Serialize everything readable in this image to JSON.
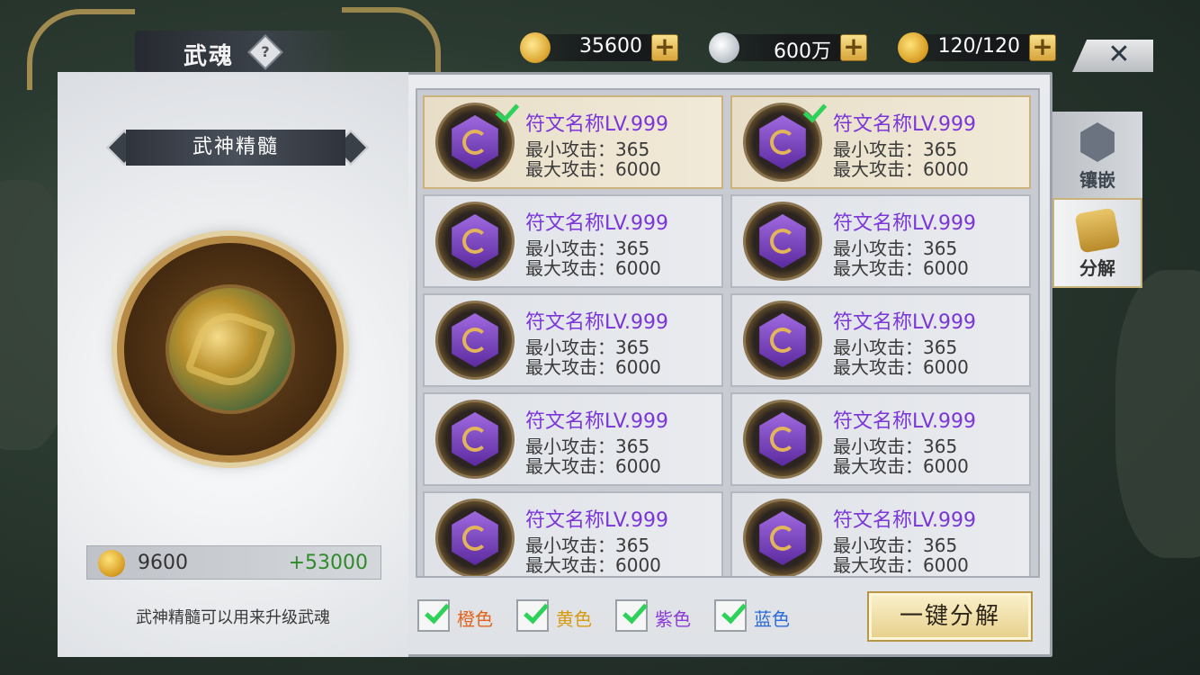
{
  "header": {
    "title": "武魂",
    "help": "?",
    "close": "✕"
  },
  "currencies": [
    {
      "icon": "gold-ingot-icon",
      "value": "35600",
      "plus": "+"
    },
    {
      "icon": "silver-ingot-icon",
      "value": "600万",
      "plus": "+"
    },
    {
      "icon": "coin-icon",
      "value": "120/120",
      "plus": "+"
    }
  ],
  "left": {
    "title": "武神精髓",
    "essence_value": "9600",
    "essence_gain": "+53000",
    "description": "武神精髓可以用来升级武魂"
  },
  "runes": [
    {
      "name": "符文名称LV.999",
      "min": "最小攻击：365",
      "max": "最大攻击：6000",
      "selected": true
    },
    {
      "name": "符文名称LV.999",
      "min": "最小攻击：365",
      "max": "最大攻击：6000",
      "selected": true
    },
    {
      "name": "符文名称LV.999",
      "min": "最小攻击：365",
      "max": "最大攻击：6000",
      "selected": false
    },
    {
      "name": "符文名称LV.999",
      "min": "最小攻击：365",
      "max": "最大攻击：6000",
      "selected": false
    },
    {
      "name": "符文名称LV.999",
      "min": "最小攻击：365",
      "max": "最大攻击：6000",
      "selected": false
    },
    {
      "name": "符文名称LV.999",
      "min": "最小攻击：365",
      "max": "最大攻击：6000",
      "selected": false
    },
    {
      "name": "符文名称LV.999",
      "min": "最小攻击：365",
      "max": "最大攻击：6000",
      "selected": false
    },
    {
      "name": "符文名称LV.999",
      "min": "最小攻击：365",
      "max": "最大攻击：6000",
      "selected": false
    },
    {
      "name": "符文名称LV.999",
      "min": "最小攻击：365",
      "max": "最大攻击：6000",
      "selected": false
    },
    {
      "name": "符文名称LV.999",
      "min": "最小攻击：365",
      "max": "最大攻击：6000",
      "selected": false
    }
  ],
  "filters": [
    {
      "label": "橙色",
      "color": "#e2641c",
      "checked": true
    },
    {
      "label": "黄色",
      "color": "#d79a10",
      "checked": true
    },
    {
      "label": "紫色",
      "color": "#8a3ad8",
      "checked": true
    },
    {
      "label": "蓝色",
      "color": "#2a6ad8",
      "checked": true
    }
  ],
  "decompose_button": "一键分解",
  "side_tabs": [
    {
      "label": "镶嵌",
      "active": false
    },
    {
      "label": "分解",
      "active": true
    }
  ]
}
